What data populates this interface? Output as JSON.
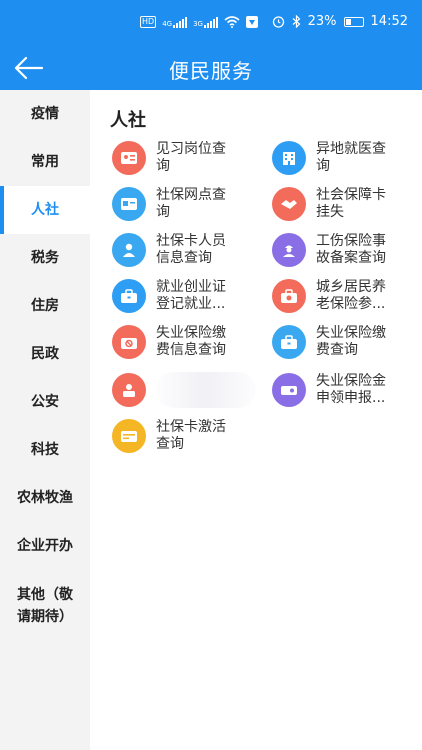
{
  "status": {
    "hd": "HD",
    "net1": "4G",
    "net2": "3G",
    "battery_pct": "23%",
    "time": "14:52"
  },
  "header": {
    "title": "便民服务"
  },
  "sidebar": {
    "items": [
      {
        "label": "疫情"
      },
      {
        "label": "常用"
      },
      {
        "label": "人社"
      },
      {
        "label": "税务"
      },
      {
        "label": "住房"
      },
      {
        "label": "民政"
      },
      {
        "label": "公安"
      },
      {
        "label": "科技"
      },
      {
        "label": "农林牧渔"
      },
      {
        "label": "企业开办"
      },
      {
        "label": "其他（敬\n请期待）"
      }
    ],
    "active_index": 2
  },
  "section": {
    "title": "人社"
  },
  "services": [
    {
      "label": "见习岗位查\n询",
      "icon": "id-card-icon",
      "color": "#f26b5b"
    },
    {
      "label": "异地就医查\n询",
      "icon": "building-icon",
      "color": "#2e9ef5"
    },
    {
      "label": "社保网点查\n询",
      "icon": "card-icon",
      "color": "#3aa8f0"
    },
    {
      "label": "社会保障卡\n挂失",
      "icon": "handshake-icon",
      "color": "#f26b5b"
    },
    {
      "label": "社保卡人员\n信息查询",
      "icon": "person-icon",
      "color": "#3aa8f0"
    },
    {
      "label": "工伤保险事\n故备案查询",
      "icon": "worker-icon",
      "color": "#8a6ee6"
    },
    {
      "label": "就业创业证\n登记就业...",
      "icon": "briefcase-icon",
      "color": "#2e9ef5"
    },
    {
      "label": "城乡居民养\n老保险参...",
      "icon": "case-icon",
      "color": "#f26b5b"
    },
    {
      "label": "失业保险缴\n费信息查询",
      "icon": "stop-icon",
      "color": "#f26b5b"
    },
    {
      "label": "失业保险缴\n费查询",
      "icon": "briefcase-icon",
      "color": "#3aa8f0"
    },
    {
      "label": "",
      "icon": "person-card-icon",
      "color": "#f26b5b"
    },
    {
      "label": "失业保险金\n申领申报...",
      "icon": "key-icon",
      "color": "#8a6ee6"
    },
    {
      "label": "社保卡激活\n查询",
      "icon": "wallet-icon",
      "color": "#f4b624"
    }
  ],
  "colors": {
    "brand": "#1e8ff0"
  }
}
